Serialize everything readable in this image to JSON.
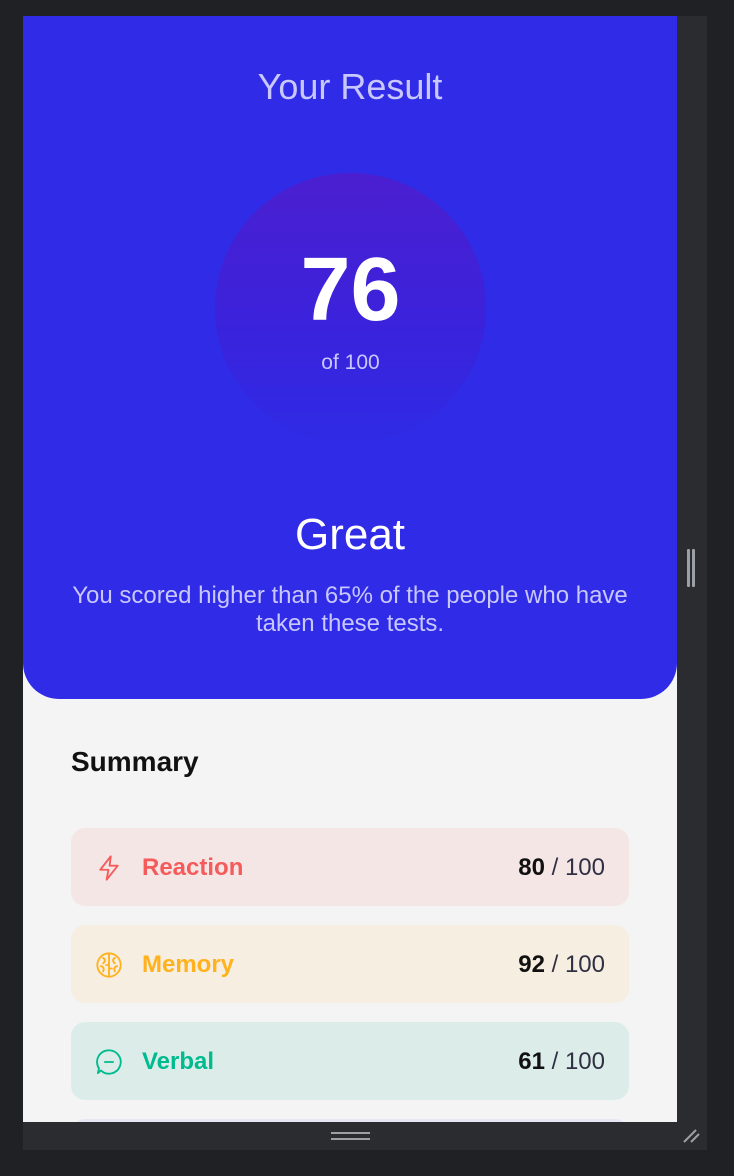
{
  "result": {
    "title": "Your Result",
    "score": "76",
    "total": "of 100",
    "rating": "Great",
    "description": "You scored higher than 65% of the people who have taken these tests."
  },
  "summary": {
    "title": "Summary",
    "items": [
      {
        "label": "Reaction",
        "score": "80",
        "max": "/ 100",
        "icon": "lightning-icon",
        "color": "#f55b5b",
        "bg": "#f5e6e6"
      },
      {
        "label": "Memory",
        "score": "92",
        "max": "/ 100",
        "icon": "brain-icon",
        "color": "#ffb21e",
        "bg": "#f6eee0"
      },
      {
        "label": "Verbal",
        "score": "61",
        "max": "/ 100",
        "icon": "chat-icon",
        "color": "#00bb8f",
        "bg": "#dcede9"
      }
    ]
  },
  "colors": {
    "panel": "#2f2be6",
    "panel_text": "#c8c7ff",
    "page_bg": "#f4f4f5"
  }
}
